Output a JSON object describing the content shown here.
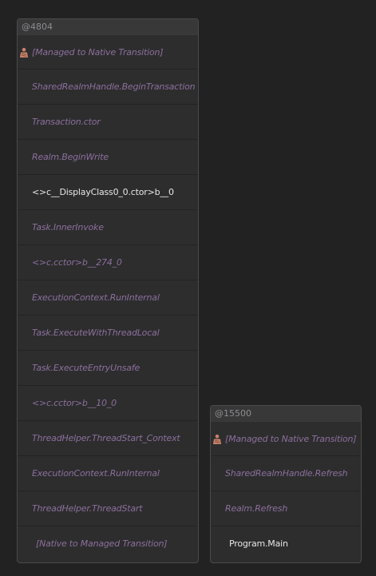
{
  "colors": {
    "background": "#222222",
    "panel": "#2d2d2e",
    "header": "#383839",
    "external_frame_text": "#8c6f9c",
    "user_frame_text": "#e6e6e6",
    "transition_icon": "#c9826b"
  },
  "threads": [
    {
      "id_label": "@4804",
      "frames": [
        {
          "label": "[Managed to Native Transition]",
          "kind": "transition-native",
          "icon": "managed-to-native-icon"
        },
        {
          "label": "SharedRealmHandle.BeginTransaction",
          "kind": "external"
        },
        {
          "label": "Transaction.ctor",
          "kind": "external"
        },
        {
          "label": "Realm.BeginWrite",
          "kind": "external"
        },
        {
          "label": "<>c__DisplayClass0_0.ctor>b__0",
          "kind": "user"
        },
        {
          "label": "Task.InnerInvoke",
          "kind": "external"
        },
        {
          "label": "<>c.cctor>b__274_0",
          "kind": "external"
        },
        {
          "label": "ExecutionContext.RunInternal",
          "kind": "external"
        },
        {
          "label": "Task.ExecuteWithThreadLocal",
          "kind": "external"
        },
        {
          "label": "Task.ExecuteEntryUnsafe",
          "kind": "external"
        },
        {
          "label": "<>c.cctor>b__10_0",
          "kind": "external"
        },
        {
          "label": "ThreadHelper.ThreadStart_Context",
          "kind": "external"
        },
        {
          "label": "ExecutionContext.RunInternal",
          "kind": "external"
        },
        {
          "label": "ThreadHelper.ThreadStart",
          "kind": "external"
        },
        {
          "label": "[Native to Managed Transition]",
          "kind": "transition-managed"
        }
      ]
    },
    {
      "id_label": "@15500",
      "frames": [
        {
          "label": "[Managed to Native Transition]",
          "kind": "transition-native",
          "icon": "managed-to-native-icon"
        },
        {
          "label": "SharedRealmHandle.Refresh",
          "kind": "external"
        },
        {
          "label": "Realm.Refresh",
          "kind": "external"
        },
        {
          "label": "Program.Main",
          "kind": "user"
        }
      ]
    }
  ]
}
